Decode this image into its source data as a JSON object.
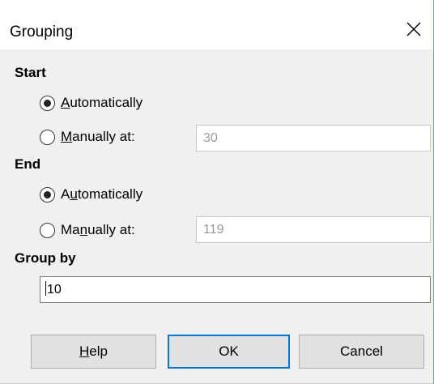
{
  "window": {
    "title": "Grouping"
  },
  "start": {
    "heading": "Start",
    "auto": {
      "pre": "",
      "key": "A",
      "post": "utomatically",
      "selected": true
    },
    "manual": {
      "pre": "",
      "key": "M",
      "post": "anually at:",
      "selected": false
    },
    "manual_value": "30"
  },
  "end": {
    "heading": "End",
    "auto": {
      "pre": "A",
      "key": "u",
      "post": "tomatically",
      "selected": true
    },
    "manual": {
      "pre": "Ma",
      "key": "n",
      "post": "ually at:",
      "selected": false
    },
    "manual_value": "119"
  },
  "group_by": {
    "heading": "Group by",
    "value": "10"
  },
  "buttons": {
    "help": {
      "pre": "",
      "key": "H",
      "post": "elp"
    },
    "ok": "OK",
    "cancel": "Cancel"
  },
  "colors": {
    "dialog_bg": "#f0f0f0",
    "title_bg": "#ffffff",
    "default_button_border": "#0078d7",
    "disabled_text": "#9a9a9a"
  },
  "icons": {
    "close": "close-icon"
  }
}
